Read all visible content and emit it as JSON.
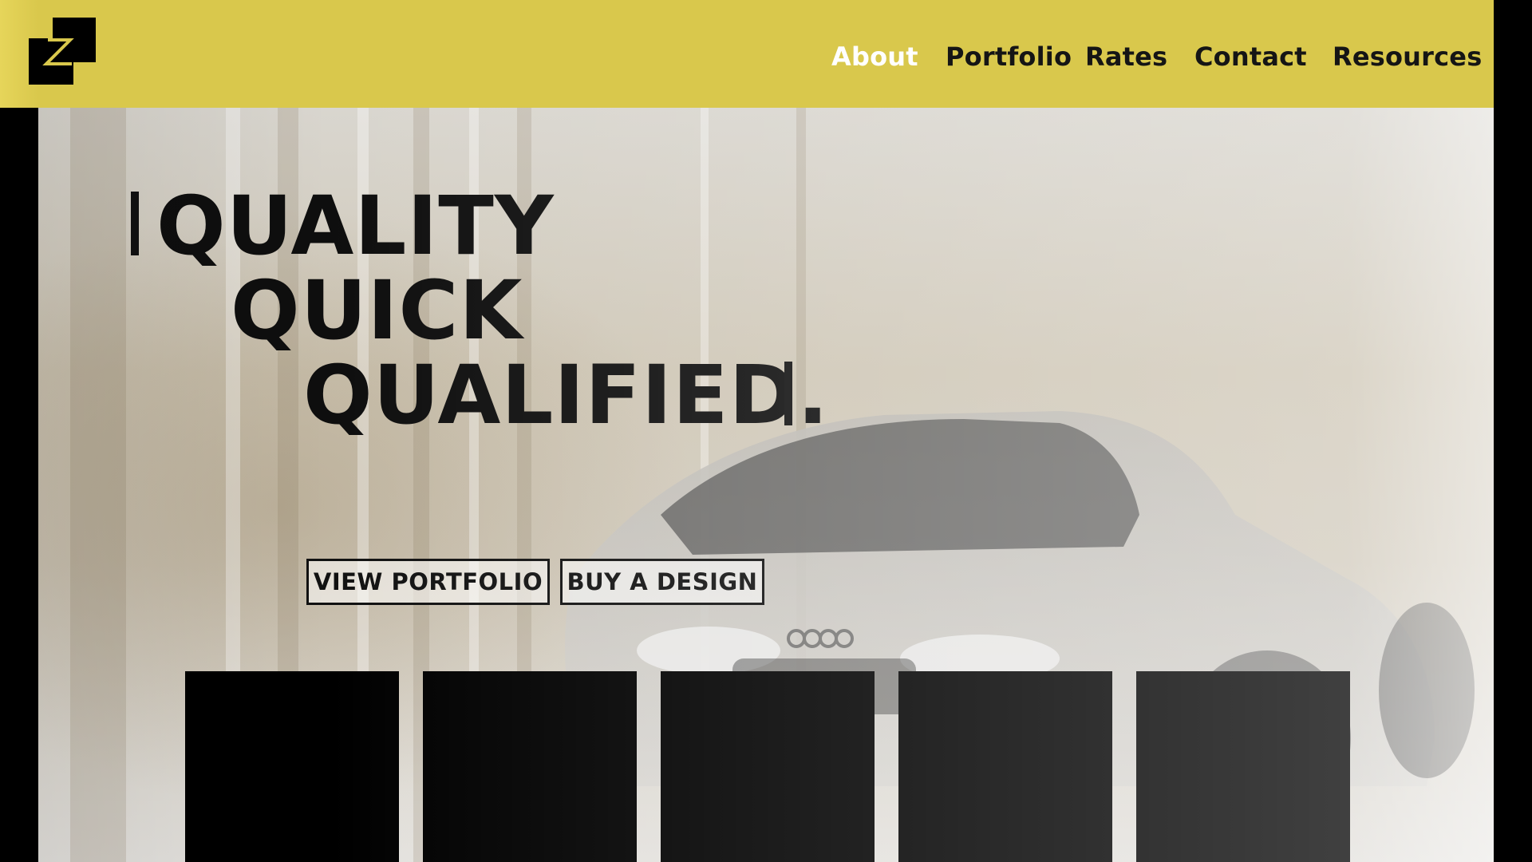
{
  "nav": {
    "items": [
      {
        "label": "About",
        "active": true
      },
      {
        "label": "Portfolio",
        "active": false
      },
      {
        "label": "Rates",
        "active": false
      },
      {
        "label": "Contact",
        "active": false
      },
      {
        "label": "Resources",
        "active": false
      }
    ]
  },
  "hero": {
    "line1": "QUALITY",
    "line2": "QUICK",
    "line3": "QUALIFIED."
  },
  "buttons": {
    "view_portfolio": "VIEW PORTFOLIO",
    "buy_design": "BUY A DESIGN"
  },
  "tiles": [
    "",
    "",
    "",
    "",
    ""
  ],
  "colors": {
    "header_bg": "#d9c84c",
    "active_nav": "#ffffff",
    "text": "#151515",
    "tile": "#000000"
  },
  "icons": {
    "logo": "z-logo-icon"
  }
}
